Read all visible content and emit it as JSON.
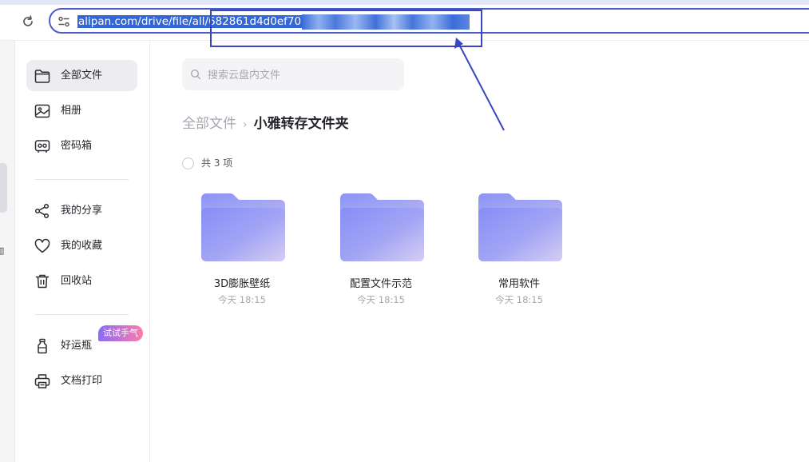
{
  "browser": {
    "url_visible": "alipan.com/drive/file/all/682861d4d0ef70"
  },
  "sidebar": {
    "items": [
      {
        "label": "全部文件",
        "icon": "folder-icon",
        "active": true
      },
      {
        "label": "相册",
        "icon": "photo-album-icon"
      },
      {
        "label": "密码箱",
        "icon": "safe-box-icon"
      },
      {
        "label": "我的分享",
        "icon": "share-icon"
      },
      {
        "label": "我的收藏",
        "icon": "heart-icon"
      },
      {
        "label": "回收站",
        "icon": "trash-icon"
      },
      {
        "label": "好运瓶",
        "icon": "bottle-icon",
        "badge": "试试手气"
      },
      {
        "label": "文档打印",
        "icon": "printer-icon"
      }
    ]
  },
  "main": {
    "search_placeholder": "搜索云盘内文件",
    "breadcrumb": {
      "root": "全部文件",
      "separator": "›",
      "current": "小雅转存文件夹"
    },
    "count_label": "共 3 项",
    "files": [
      {
        "name": "3D膨胀壁纸",
        "time": "今天 18:15"
      },
      {
        "name": "配置文件示范",
        "time": "今天 18:15"
      },
      {
        "name": "常用软件",
        "time": "今天 18:15"
      }
    ]
  },
  "colors": {
    "annotation": "#3846c1",
    "selection": "#3367d6",
    "folder_gradient": [
      "#8890f8",
      "#cdc7f2"
    ],
    "badge_gradient": [
      "#8a6bf5",
      "#ff7bac"
    ]
  }
}
